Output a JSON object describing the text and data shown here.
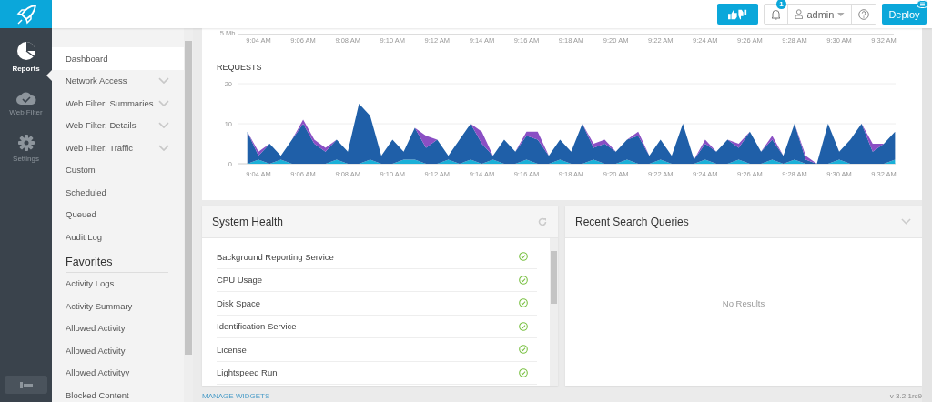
{
  "nav_rail": {
    "items": [
      {
        "kind": "reports",
        "label": "Reports",
        "selected": true
      },
      {
        "kind": "webfilter",
        "label": "Web Filter",
        "selected": false
      },
      {
        "kind": "settings",
        "label": "Settings",
        "selected": false
      }
    ]
  },
  "top_bar": {
    "notifications_badge": "1",
    "user": "admin",
    "deploy": "Deploy"
  },
  "sub_sidebar": {
    "items": [
      {
        "label": "Dashboard",
        "selected": true,
        "expandable": false
      },
      {
        "label": "Network Access",
        "selected": false,
        "expandable": true
      },
      {
        "label": "Web Filter: Summaries",
        "selected": false,
        "expandable": true
      },
      {
        "label": "Web Filter: Details",
        "selected": false,
        "expandable": true
      },
      {
        "label": "Web Filter: Traffic",
        "selected": false,
        "expandable": true
      },
      {
        "label": "Custom",
        "selected": false,
        "expandable": false
      },
      {
        "label": "Scheduled",
        "selected": false,
        "expandable": false
      },
      {
        "label": "Queued",
        "selected": false,
        "expandable": false
      },
      {
        "label": "Audit Log",
        "selected": false,
        "expandable": false
      }
    ],
    "favorites_title": "Favorites",
    "favorites": [
      {
        "label": "Activity Logs",
        "selected": false
      },
      {
        "label": "Activity Summary",
        "selected": false
      },
      {
        "label": "Allowed Activity",
        "selected": false
      },
      {
        "label": "Allowed Activity",
        "selected": false
      },
      {
        "label": "Allowed Activityy",
        "selected": false
      },
      {
        "label": "Blocked Content",
        "selected": false
      }
    ]
  },
  "bandwidth_chart": {
    "y_label": "5 Mb",
    "x_labels": [
      "9:04 AM",
      "9:06 AM",
      "9:08 AM",
      "9:10 AM",
      "9:12 AM",
      "9:14 AM",
      "9:16 AM",
      "9:18 AM",
      "9:20 AM",
      "9:22 AM",
      "9:24 AM",
      "9:26 AM",
      "9:28 AM",
      "9:30 AM",
      "9:32 AM"
    ]
  },
  "requests_chart": {
    "title": "REQUESTS",
    "chart_data": {
      "type": "area",
      "stacked": true,
      "ylim": [
        0,
        20
      ],
      "yticks": [
        0,
        10,
        20
      ],
      "categories": [
        null,
        "9:04 AM",
        null,
        null,
        null,
        "9:06 AM",
        null,
        null,
        null,
        "9:08 AM",
        null,
        null,
        null,
        "9:10 AM",
        null,
        null,
        null,
        "9:12 AM",
        null,
        null,
        null,
        "9:14 AM",
        null,
        null,
        null,
        "9:16 AM",
        null,
        null,
        null,
        "9:18 AM",
        null,
        null,
        null,
        "9:20 AM",
        null,
        null,
        null,
        "9:22 AM",
        null,
        null,
        null,
        "9:24 AM",
        null,
        null,
        null,
        "9:26 AM",
        null,
        null,
        null,
        "9:28 AM",
        null,
        null,
        null,
        "9:30 AM",
        null,
        null,
        null,
        "9:32 AM",
        null
      ],
      "series": [
        {
          "color": "#1ab0d8",
          "values": [
            0,
            1,
            0,
            1,
            0,
            0,
            0,
            0,
            1,
            0,
            0,
            1,
            0,
            0,
            1,
            1,
            0,
            0,
            1,
            0,
            1,
            0,
            1,
            0,
            0,
            1,
            0,
            0,
            1,
            0,
            0,
            1,
            0,
            0,
            1,
            0,
            0,
            1,
            0,
            0,
            0,
            1,
            0,
            0,
            1,
            0,
            0,
            1,
            0,
            1,
            0,
            0,
            0,
            1,
            0,
            0,
            0,
            0,
            1
          ]
        },
        {
          "color": "#1f5fa8",
          "values": [
            8,
            1,
            5,
            1,
            6,
            10,
            5,
            3,
            5,
            3,
            15,
            11,
            2,
            6,
            2,
            8,
            4,
            6,
            1,
            6,
            9,
            5,
            1,
            6,
            3,
            6,
            6,
            2,
            5,
            3,
            10,
            3,
            5,
            3,
            5,
            7,
            2,
            5,
            2,
            10,
            1,
            4,
            3,
            6,
            3,
            8,
            3,
            5,
            2,
            9,
            1,
            0,
            10,
            2,
            6,
            10,
            3,
            5,
            7
          ]
        },
        {
          "color": "#8a4fc4",
          "values": [
            0,
            1,
            0,
            null,
            0,
            1,
            1,
            1,
            0,
            null,
            null,
            null,
            null,
            null,
            null,
            0,
            3,
            0,
            null,
            null,
            0,
            3,
            0,
            null,
            0,
            1,
            2,
            0,
            null,
            null,
            0,
            1,
            1,
            0,
            0,
            1,
            0,
            null,
            null,
            null,
            0,
            1,
            0,
            0,
            1,
            0,
            0,
            1,
            0,
            0,
            1,
            0,
            null,
            null,
            null,
            0,
            2,
            0,
            null
          ]
        }
      ]
    }
  },
  "system_health": {
    "title": "System Health",
    "items": [
      {
        "label": "Background Reporting Service",
        "ok": true
      },
      {
        "label": "CPU Usage",
        "ok": true
      },
      {
        "label": "Disk Space",
        "ok": true
      },
      {
        "label": "Identification Service",
        "ok": true
      },
      {
        "label": "License",
        "ok": true
      },
      {
        "label": "Lightspeed Run",
        "ok": true
      }
    ]
  },
  "recent_search_queries": {
    "title": "Recent Search Queries",
    "empty_text": "No Results"
  },
  "footer": {
    "manage_widgets": "MANAGE WIDGETS",
    "version": "v 3.2.1rc9"
  }
}
